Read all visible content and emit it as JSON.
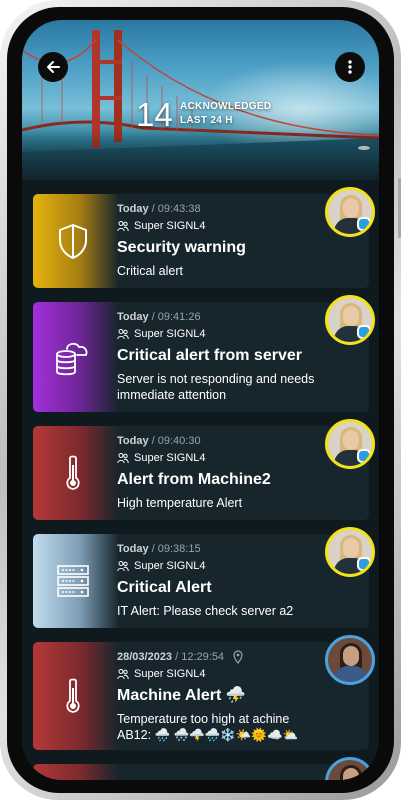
{
  "header": {
    "back_icon": "arrow-left-icon",
    "menu_icon": "more-vertical-icon",
    "count": "14",
    "label_line1": "ACKNOWLEDGED",
    "label_line2": "LAST 24 H"
  },
  "alerts": [
    {
      "date": "Today",
      "time": " / 09:43:38",
      "user": "Super SIGNL4",
      "title": "Security warning",
      "description": "Critical alert",
      "icon": "shield-icon",
      "colors": [
        "#e8b60c",
        "#2a2a1a"
      ]
    },
    {
      "date": "Today",
      "time": " / 09:41:26",
      "user": "Super SIGNL4",
      "title": "Critical alert from server",
      "description": "Server is not responding and needs immediate attention",
      "icon": "cloud-database-icon",
      "colors": [
        "#a02fd6",
        "#2a1a32"
      ]
    },
    {
      "date": "Today",
      "time": " / 09:40:30",
      "user": "Super SIGNL4",
      "title": "Alert from Machine2",
      "description": "High temperature Alert",
      "icon": "thermometer-icon",
      "colors": [
        "#b53a3a",
        "#2a1c22"
      ]
    },
    {
      "date": "Today",
      "time": " / 09:38:15",
      "user": "Super SIGNL4",
      "title": "Critical Alert",
      "description": "IT Alert: Please check server a2",
      "icon": "server-rack-icon",
      "colors": [
        "#b9d3e6",
        "#1e2c36"
      ]
    },
    {
      "date": "28/03/2023",
      "time": " / 12:29:54",
      "user": "Super SIGNL4",
      "title": "Machine Alert ⛈️",
      "description": "Temperature too high at achine AB12: 🌧️ 🌨️🌩️🌧️❄️🌤️🌞☁️⛅",
      "icon": "thermometer-icon",
      "colors": [
        "#b53a3a",
        "#2a1c22"
      ]
    }
  ]
}
